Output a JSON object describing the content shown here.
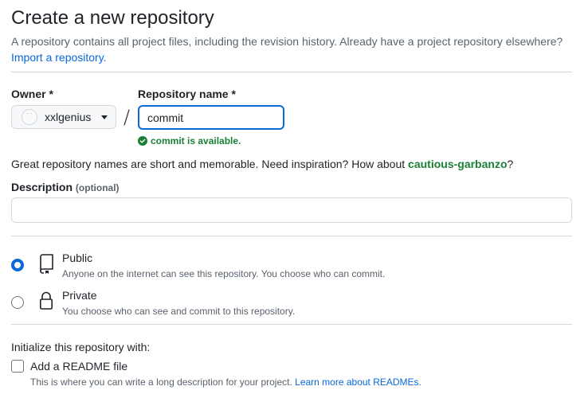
{
  "header": {
    "title": "Create a new repository",
    "intro": "A repository contains all project files, including the revision history. Already have a project repository elsewhere?",
    "import_link": "Import a repository."
  },
  "owner": {
    "label": "Owner *",
    "value": "xxlgenius",
    "avatar_icon": "avatar-icon"
  },
  "repo_name": {
    "label": "Repository name *",
    "separator": "/",
    "value": "commit",
    "availability": "commit is available."
  },
  "suggestion": {
    "prefix": "Great repository names are short and memorable. Need inspiration? How about ",
    "name": "cautious-garbanzo",
    "suffix": "?"
  },
  "description": {
    "label": "Description",
    "optional": "(optional)",
    "value": ""
  },
  "visibility": [
    {
      "title": "Public",
      "desc": "Anyone on the internet can see this repository. You choose who can commit.",
      "icon": "repo-icon",
      "checked": true
    },
    {
      "title": "Private",
      "desc": "You choose who can see and commit to this repository.",
      "icon": "lock-icon",
      "checked": false
    }
  ],
  "initialize": {
    "heading": "Initialize this repository with:",
    "readme_label": "Add a README file",
    "readme_desc": "This is where you can write a long description for your project. ",
    "readme_link": "Learn more about READMEs."
  },
  "colors": {
    "accent": "#0969da",
    "success": "#1a7f37",
    "border": "#d1d9e0",
    "muted": "#59636e"
  }
}
